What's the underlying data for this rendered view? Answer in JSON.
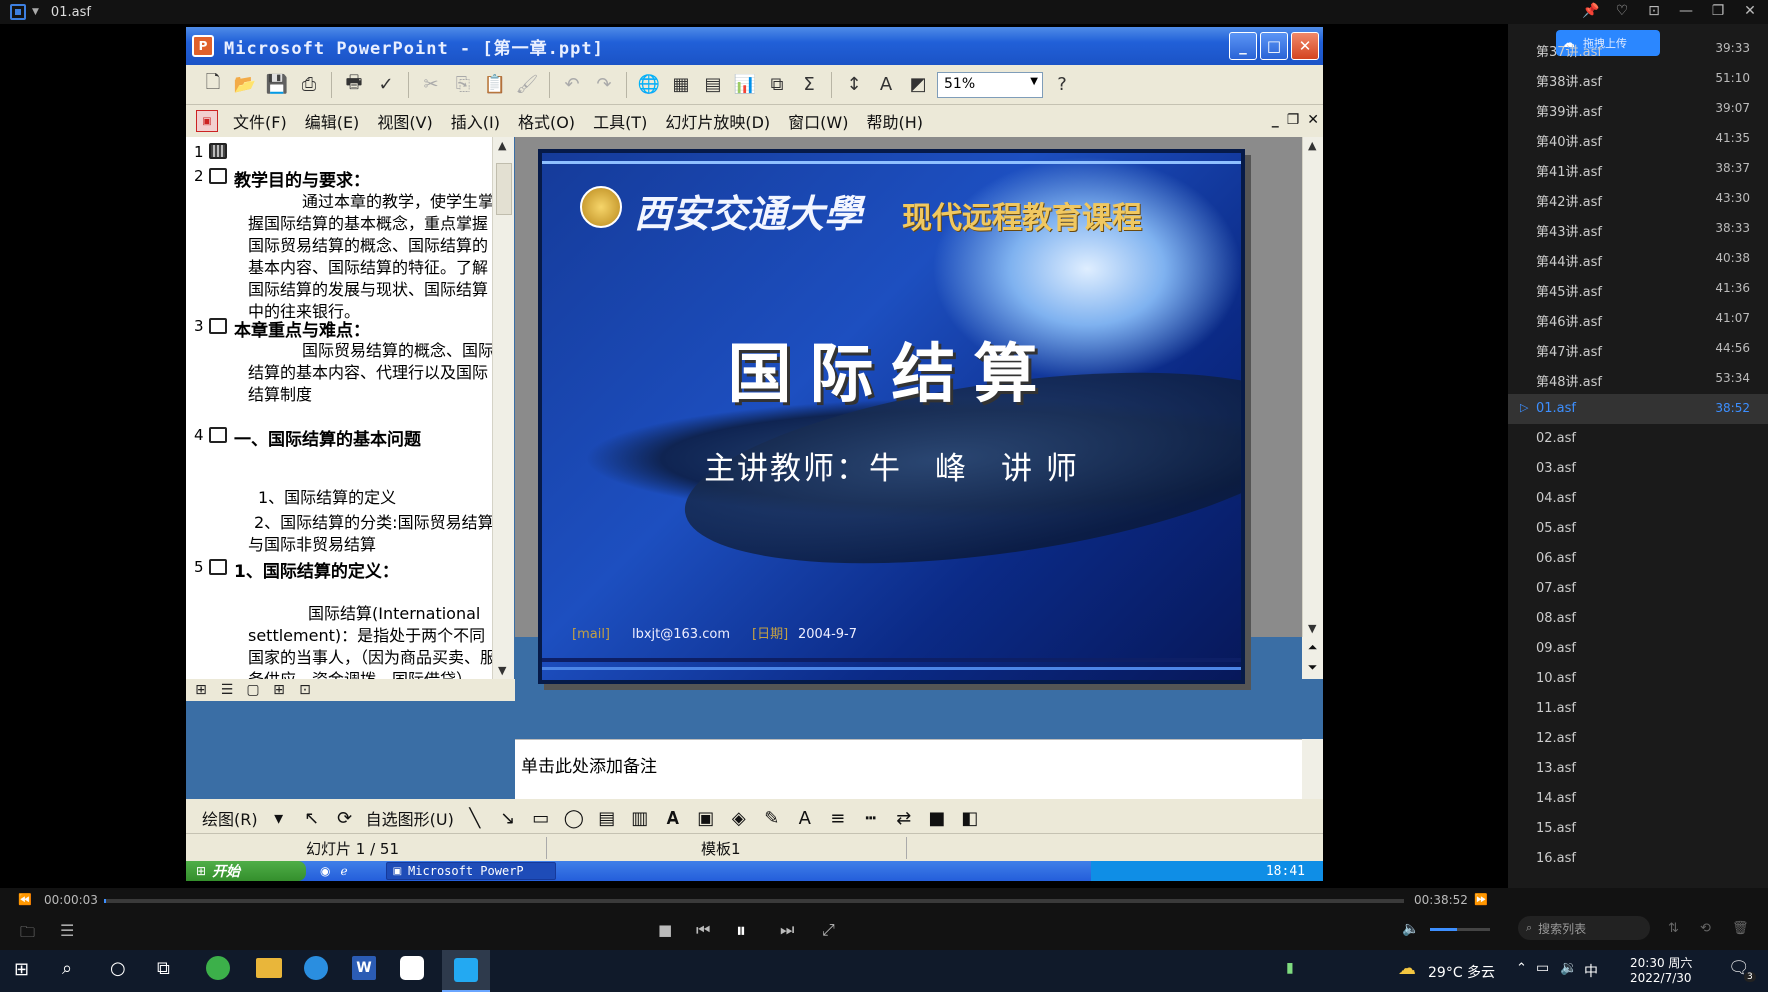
{
  "player": {
    "title": "01.asf",
    "window_buttons": [
      "📌",
      "♡",
      "⊡",
      "—",
      "❐",
      "✕"
    ],
    "upload_label": "拖拽上传",
    "time_current": "00:00:03",
    "time_total": "00:38:52",
    "progress_fraction": 0.0013,
    "volume_fraction": 0.45,
    "search_placeholder": "搜索列表"
  },
  "playlist": [
    {
      "name": "第37讲.asf",
      "duration": "39:33",
      "active": false
    },
    {
      "name": "第38讲.asf",
      "duration": "51:10",
      "active": false
    },
    {
      "name": "第39讲.asf",
      "duration": "39:07",
      "active": false
    },
    {
      "name": "第40讲.asf",
      "duration": "41:35",
      "active": false
    },
    {
      "name": "第41讲.asf",
      "duration": "38:37",
      "active": false
    },
    {
      "name": "第42讲.asf",
      "duration": "43:30",
      "active": false
    },
    {
      "name": "第43讲.asf",
      "duration": "38:33",
      "active": false
    },
    {
      "name": "第44讲.asf",
      "duration": "40:38",
      "active": false
    },
    {
      "name": "第45讲.asf",
      "duration": "41:36",
      "active": false
    },
    {
      "name": "第46讲.asf",
      "duration": "41:07",
      "active": false
    },
    {
      "name": "第47讲.asf",
      "duration": "44:56",
      "active": false
    },
    {
      "name": "第48讲.asf",
      "duration": "53:34",
      "active": false
    },
    {
      "name": "01.asf",
      "duration": "38:52",
      "active": true
    },
    {
      "name": "02.asf",
      "duration": "",
      "active": false
    },
    {
      "name": "03.asf",
      "duration": "",
      "active": false
    },
    {
      "name": "04.asf",
      "duration": "",
      "active": false
    },
    {
      "name": "05.asf",
      "duration": "",
      "active": false
    },
    {
      "name": "06.asf",
      "duration": "",
      "active": false
    },
    {
      "name": "07.asf",
      "duration": "",
      "active": false
    },
    {
      "name": "08.asf",
      "duration": "",
      "active": false
    },
    {
      "name": "09.asf",
      "duration": "",
      "active": false
    },
    {
      "name": "10.asf",
      "duration": "",
      "active": false
    },
    {
      "name": "11.asf",
      "duration": "",
      "active": false
    },
    {
      "name": "12.asf",
      "duration": "",
      "active": false
    },
    {
      "name": "13.asf",
      "duration": "",
      "active": false
    },
    {
      "name": "14.asf",
      "duration": "",
      "active": false
    },
    {
      "name": "15.asf",
      "duration": "",
      "active": false
    },
    {
      "name": "16.asf",
      "duration": "",
      "active": false
    }
  ],
  "powerpoint": {
    "title": "Microsoft PowerPoint - [第一章.ppt]",
    "zoom": "51%",
    "menu": [
      "文件(F)",
      "编辑(E)",
      "视图(V)",
      "插入(I)",
      "格式(O)",
      "工具(T)",
      "幻灯片放映(D)",
      "窗口(W)",
      "帮助(H)"
    ],
    "outline": {
      "s1_num": "1",
      "s2_num": "2",
      "s2_head": "教学目的与要求：",
      "s2_body": "通过本章的教学，使学生掌握国际结算的基本概念，重点掌握国际贸易结算的概念、国际结算的基本内容、国际结算的特征。了解国际结算的发展与现状、国际结算中的往来银行。",
      "s3_num": "3",
      "s3_head": "本章重点与难点：",
      "s3_body": "国际贸易结算的概念、国际结算的基本内容、代理行以及国际结算制度",
      "s4_num": "4",
      "s4_head": "一、国际结算的基本问题",
      "s4_item1": "1、国际结算的定义",
      "s4_item2": "2、国际结算的分类:国际贸易结算与国际非贸易结算",
      "s5_num": "5",
      "s5_head": "1、国际结算的定义：",
      "s5_body": "国际结算(International settlement)：是指处于两个不同国家的当事人，（因为商品买卖、服务供应、资金调拨、国际借贷）"
    },
    "slide": {
      "university": "西安交通大學",
      "course": "现代远程教育课程",
      "title": "国际结算",
      "lecturer": "主讲教师：牛　峰　讲 师",
      "email_label": "[mail]",
      "email": "lbxjt@163.com",
      "date_label": "[日期]",
      "date": "2004-9-7"
    },
    "notes_placeholder": "单击此处添加备注",
    "draw_label": "绘图(R)",
    "autoshape_label": "自选图形(U)",
    "status_slide": "幻灯片 1 / 51",
    "status_template": "模板1"
  },
  "xp_taskbar": {
    "start": "开始",
    "task": "Microsoft PowerP",
    "clock": "18:41"
  },
  "win_taskbar": {
    "weather": "29°C 多云",
    "ime": "中",
    "time": "20:30 周六",
    "date": "2022/7/30",
    "notification_count": "3"
  },
  "colors": {
    "accent": "#3d7fe0",
    "active_item": "#3d8fff",
    "playlist_bg": "#1a1a1a"
  }
}
